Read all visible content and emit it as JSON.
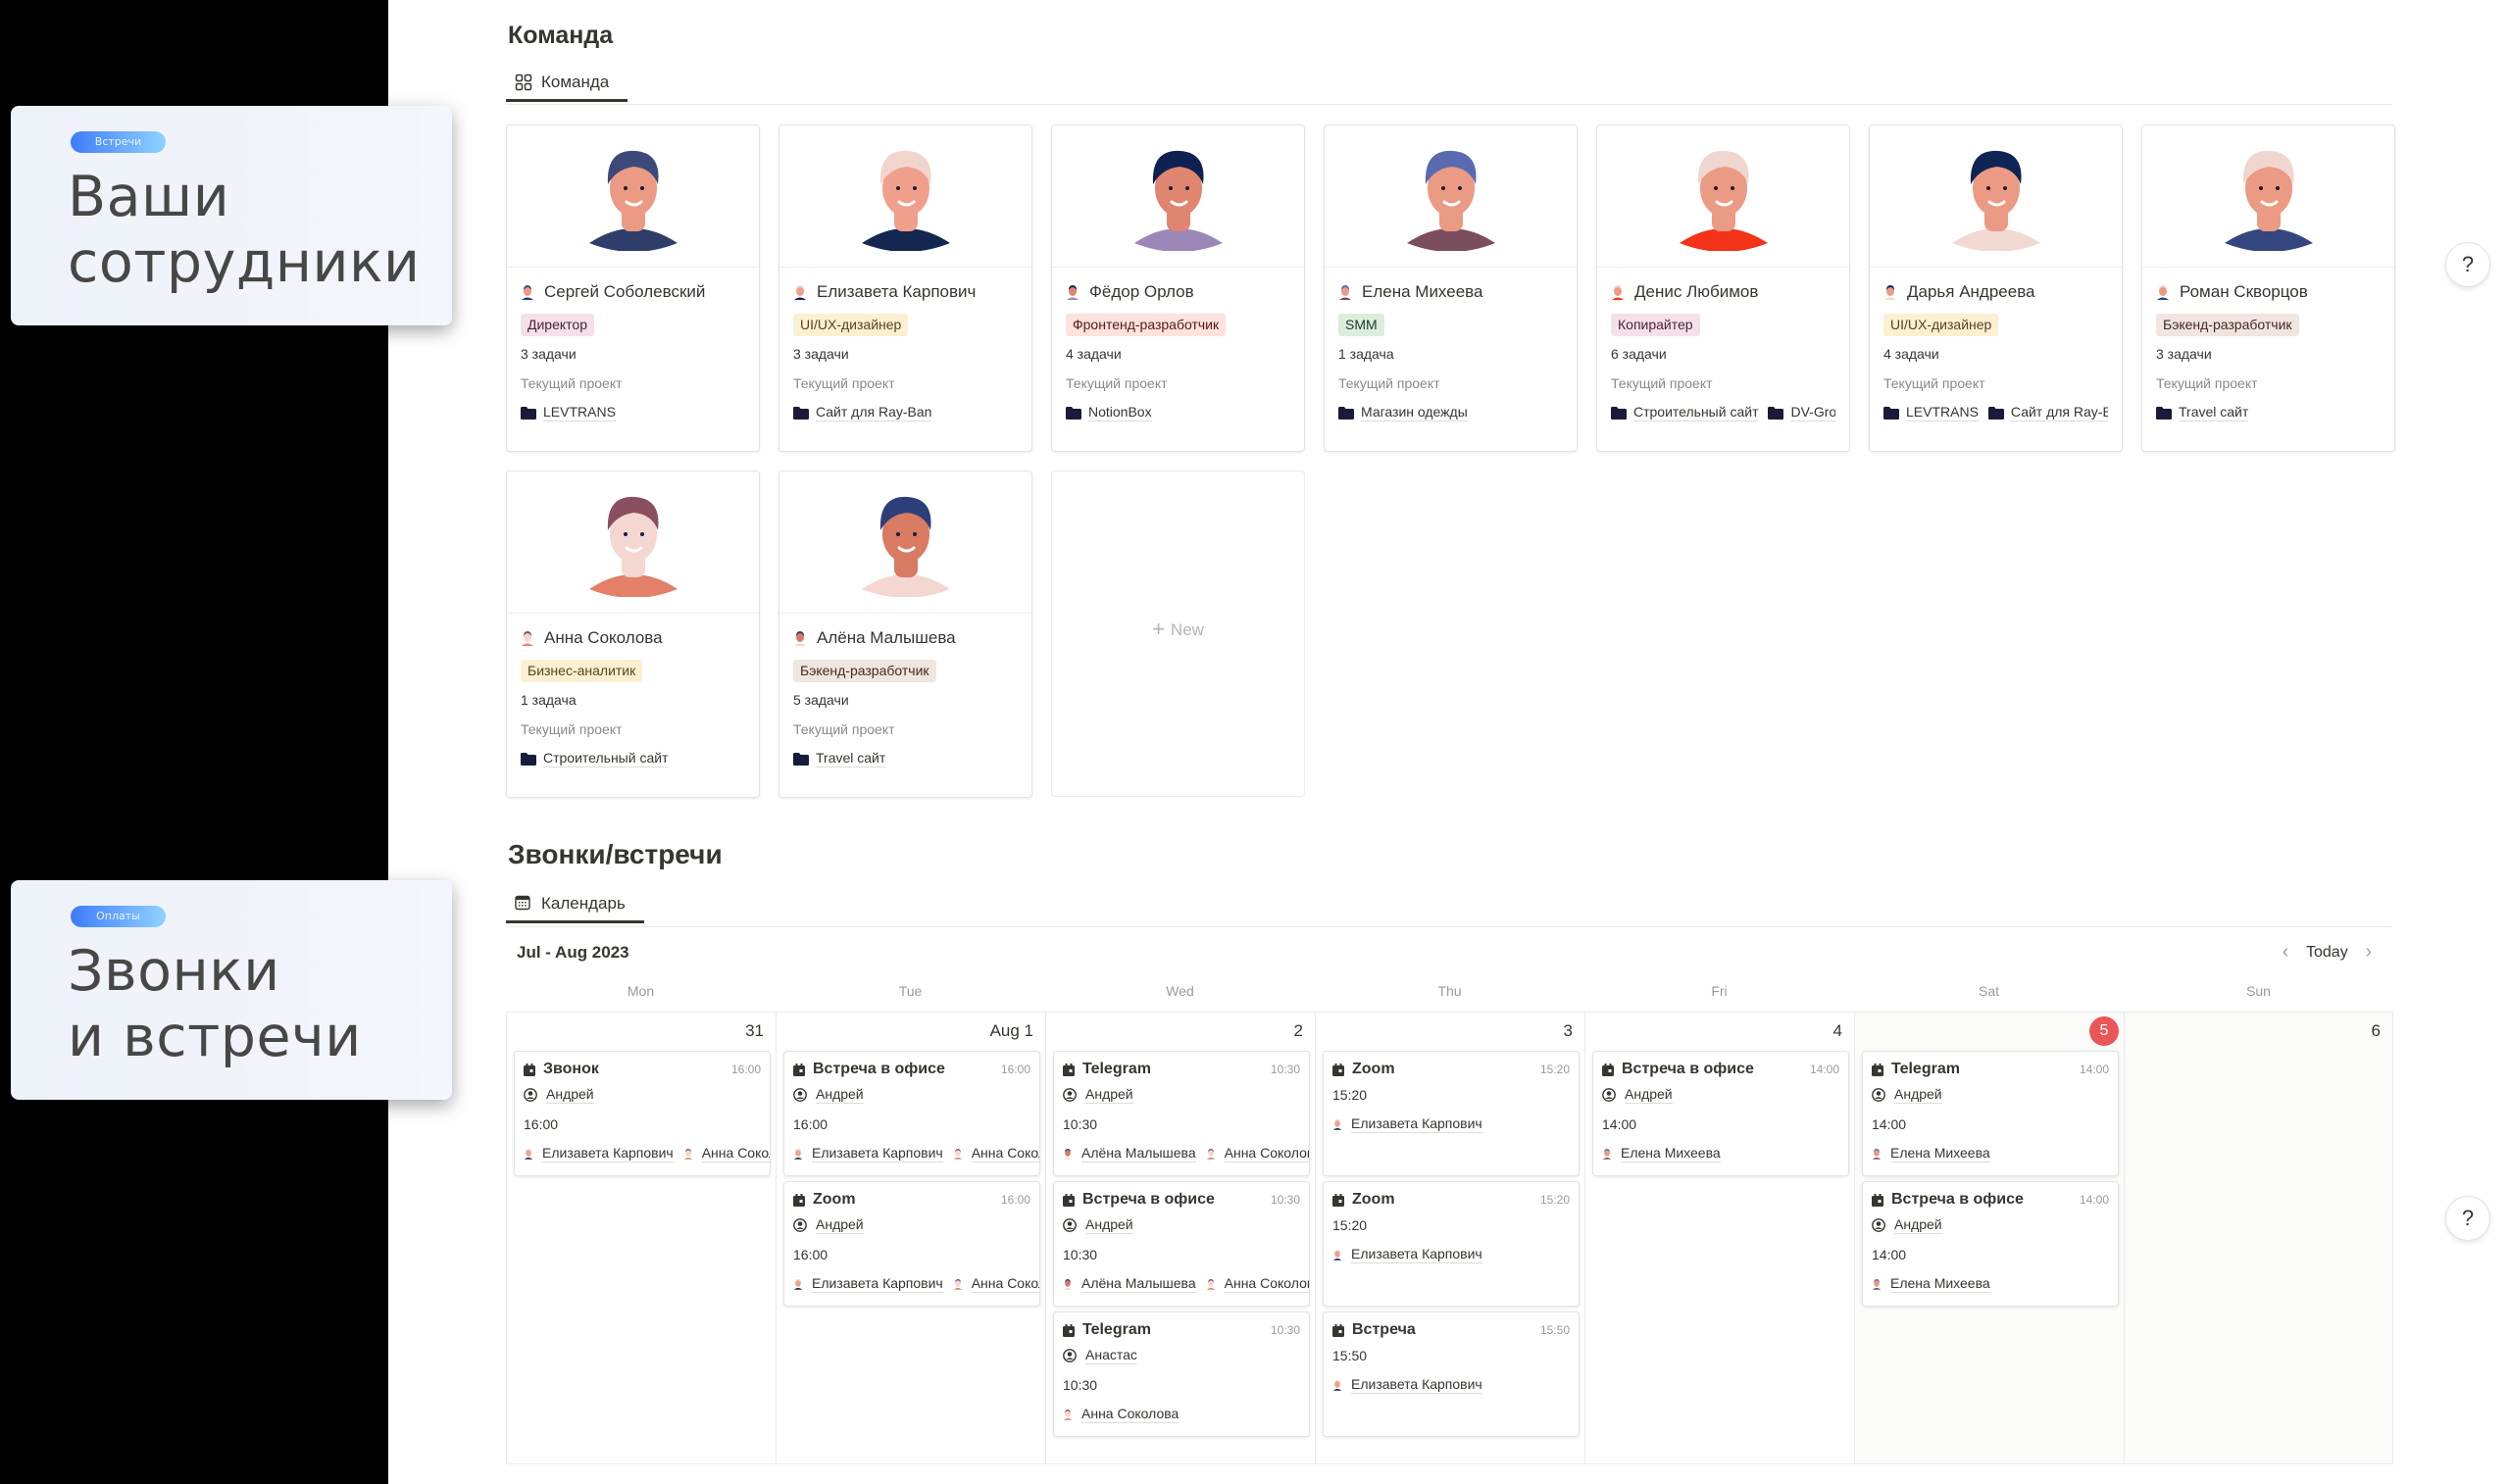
{
  "promos": [
    {
      "badge": "Встречи",
      "title": "Ваши\nсотрудники"
    },
    {
      "badge": "Оплаты",
      "title": "Звонки\nи встречи"
    }
  ],
  "team": {
    "title": "Команда",
    "tab_label": "Команда",
    "current_project_label": "Текущий проект",
    "new_label": "New",
    "members": [
      {
        "name": "Сергей Соболевский",
        "role": "Директор",
        "role_bg": "#f5e0e9",
        "role_fg": "#4c2337",
        "tasks": "3 задачи",
        "projects": [
          "LEVTRANS"
        ],
        "hair": "#3b4a7a",
        "shirt": "#2f3d6b",
        "skin": "#eb9a83"
      },
      {
        "name": "Елизавета Карпович",
        "role": "UI/UX-дизайнер",
        "role_bg": "#fbf0d1",
        "role_fg": "#5a4320",
        "tasks": "3 задачи",
        "projects": [
          "Сайт для Ray-Ban"
        ],
        "hair": "#f0d5cd",
        "shirt": "#142751",
        "skin": "#f0a08a"
      },
      {
        "name": "Фёдор Орлов",
        "role": "Фронтенд-разработчик",
        "role_bg": "#fde2dd",
        "role_fg": "#5d1715",
        "tasks": "4 задачи",
        "projects": [
          "NotionBox"
        ],
        "hair": "#0f2150",
        "shirt": "#9b87b8",
        "skin": "#df8570"
      },
      {
        "name": "Елена Михеева",
        "role": "SMM",
        "role_bg": "#dbeddb",
        "role_fg": "#1c3829",
        "tasks": "1 задача",
        "projects": [
          "Магазин одежды"
        ],
        "hair": "#5a6ab0",
        "shirt": "#7b4e5e",
        "skin": "#eb9a83"
      },
      {
        "name": "Денис Любимов",
        "role": "Копирайтер",
        "role_bg": "#f5e0e9",
        "role_fg": "#4c2337",
        "tasks": "6 задачи",
        "projects": [
          "Строительный сайт",
          "DV-Group"
        ],
        "hair": "#efd6cf",
        "shirt": "#f2331a",
        "skin": "#eb9a83"
      },
      {
        "name": "Дарья Андреева",
        "role": "UI/UX-дизайнер",
        "role_bg": "#fbf0d1",
        "role_fg": "#5a4320",
        "tasks": "4 задачи",
        "projects": [
          "LEVTRANS",
          "Сайт для Ray-Ban"
        ],
        "hair": "#0e2455",
        "shirt": "#f1d9d2",
        "skin": "#eb9a83"
      },
      {
        "name": "Роман Скворцов",
        "role": "Бэкенд-разработчик",
        "role_bg": "#f1e5df",
        "role_fg": "#442a1e",
        "tasks": "3 задачи",
        "projects": [
          "Travel сайт"
        ],
        "hair": "#f0d6cf",
        "shirt": "#35467e",
        "skin": "#eb9a83"
      },
      {
        "name": "Анна Соколова",
        "role": "Бизнес-аналитик",
        "role_bg": "#fbf0d1",
        "role_fg": "#5a4320",
        "tasks": "1 задача",
        "projects": [
          "Строительный сайт"
        ],
        "hair": "#8a4f5e",
        "shirt": "#e47f68",
        "skin": "#f3d7d0"
      },
      {
        "name": "Алёна Малышева",
        "role": "Бэкенд-разработчик",
        "role_bg": "#f1e5df",
        "role_fg": "#442a1e",
        "tasks": "5 задачи",
        "projects": [
          "Travel сайт"
        ],
        "hair": "#2d3e78",
        "shirt": "#f3d7d0",
        "skin": "#d97a63"
      }
    ]
  },
  "calls": {
    "title": "Звонки/встречи",
    "tab_label": "Календарь",
    "range": "Jul - Aug 2023",
    "today_label": "Today",
    "weekdays": [
      "Mon",
      "Tue",
      "Wed",
      "Thu",
      "Fri",
      "Sat",
      "Sun"
    ],
    "days": [
      {
        "label": "31",
        "today": false,
        "weekend": false,
        "events": [
          {
            "title": "Звонок",
            "time": "16:00",
            "host": "Андрей",
            "start": "16:00",
            "attendees": [
              "Елизавета Карпович",
              "Анна Соколова"
            ]
          }
        ]
      },
      {
        "label": "Aug 1",
        "today": false,
        "weekend": false,
        "events": [
          {
            "title": "Встреча в офисе",
            "time": "16:00",
            "host": "Андрей",
            "start": "16:00",
            "attendees": [
              "Елизавета Карпович",
              "Анна Соколова"
            ]
          },
          {
            "title": "Zoom",
            "time": "16:00",
            "host": "Андрей",
            "start": "16:00",
            "attendees": [
              "Елизавета Карпович",
              "Анна Соколова"
            ]
          }
        ]
      },
      {
        "label": "2",
        "today": false,
        "weekend": false,
        "events": [
          {
            "title": "Telegram",
            "time": "10:30",
            "host": "Андрей",
            "start": "10:30",
            "attendees": [
              "Алёна Малышева",
              "Анна Соколова"
            ]
          },
          {
            "title": "Встреча в офисе",
            "time": "10:30",
            "host": "Андрей",
            "start": "10:30",
            "attendees": [
              "Алёна Малышева",
              "Анна Соколова"
            ]
          },
          {
            "title": "Telegram",
            "time": "10:30",
            "host": "Анастас",
            "start": "10:30",
            "attendees": [
              "Анна Соколова"
            ]
          }
        ]
      },
      {
        "label": "3",
        "today": false,
        "weekend": false,
        "events": [
          {
            "title": "Zoom",
            "time": "15:20",
            "host": null,
            "start": "15:20",
            "attendees": [
              "Елизавета Карпович"
            ]
          },
          {
            "title": "Zoom",
            "time": "15:20",
            "host": null,
            "start": "15:20",
            "attendees": [
              "Елизавета Карпович"
            ]
          },
          {
            "title": "Встреча",
            "time": "15:50",
            "host": null,
            "start": "15:50",
            "attendees": [
              "Елизавета Карпович"
            ]
          }
        ]
      },
      {
        "label": "4",
        "today": false,
        "weekend": false,
        "events": [
          {
            "title": "Встреча в офисе",
            "time": "14:00",
            "host": "Андрей",
            "start": "14:00",
            "attendees": [
              "Елена Михеева"
            ]
          }
        ]
      },
      {
        "label": "5",
        "today": true,
        "weekend": true,
        "events": [
          {
            "title": "Telegram",
            "time": "14:00",
            "host": "Андрей",
            "start": "14:00",
            "attendees": [
              "Елена Михеева"
            ]
          },
          {
            "title": "Встреча в офисе",
            "time": "14:00",
            "host": "Андрей",
            "start": "14:00",
            "attendees": [
              "Елена Михеева"
            ]
          }
        ]
      },
      {
        "label": "6",
        "today": false,
        "weekend": true,
        "events": []
      }
    ]
  },
  "help_label": "?",
  "colors": {
    "today_badge": "#eb5757",
    "text": "#37352f",
    "muted": "#9b9a97"
  }
}
